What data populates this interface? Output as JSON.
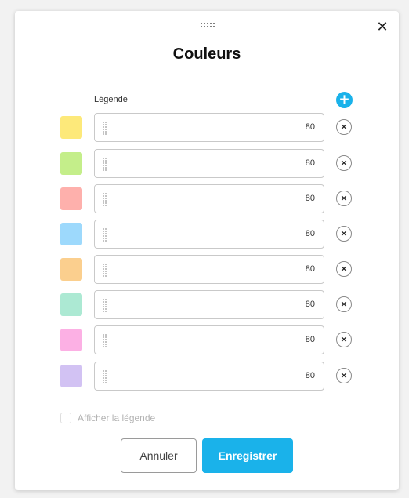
{
  "dialog": {
    "title": "Couleurs",
    "close_icon": "close-icon",
    "legend_header": "Légende",
    "add_icon": "+",
    "remove_icon": "×",
    "close_glyph": "✕"
  },
  "colors": [
    {
      "swatch": "#fde97a",
      "label": "",
      "opacity": "80"
    },
    {
      "swatch": "#c4ee8a",
      "label": "",
      "opacity": "80"
    },
    {
      "swatch": "#feb0ac",
      "label": "",
      "opacity": "80"
    },
    {
      "swatch": "#9dd9fc",
      "label": "",
      "opacity": "80"
    },
    {
      "swatch": "#fbcf8e",
      "label": "",
      "opacity": "80"
    },
    {
      "swatch": "#ace9d3",
      "label": "",
      "opacity": "80"
    },
    {
      "swatch": "#fcb0e4",
      "label": "",
      "opacity": "80"
    },
    {
      "swatch": "#d2c2f3",
      "label": "",
      "opacity": "80"
    }
  ],
  "footer": {
    "show_legend_label": "Afficher la légende",
    "show_legend_checked": false,
    "cancel_label": "Annuler",
    "save_label": "Enregistrer"
  },
  "theme": {
    "accent": "#1ab2ea"
  }
}
